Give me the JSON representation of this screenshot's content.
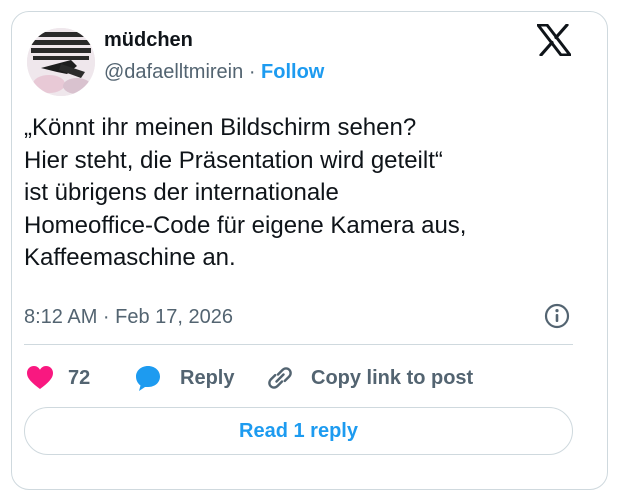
{
  "author": {
    "display_name": "müdchen",
    "handle": "@dafaelltmirein",
    "separator": "·",
    "follow_label": "Follow"
  },
  "tweet": {
    "lines": [
      "„Könnt ihr meinen Bildschirm sehen?",
      "Hier steht, die Präsentation wird geteilt“",
      "ist übrigens der internationale",
      "Homeoffice-Code für eigene Kamera aus,",
      "Kaffeemaschine an."
    ],
    "timestamp": "8:12 AM · Feb 17, 2026"
  },
  "actions": {
    "like_count": "72",
    "reply_label": "Reply",
    "copy_link_label": "Copy link to post",
    "read_replies_label": "Read 1 reply"
  },
  "icons": {
    "brand": "x-logo-icon",
    "info": "info-icon",
    "like": "heart-icon",
    "reply": "speech-bubble-icon",
    "copy": "link-icon"
  },
  "colors": {
    "accent": "#1d9bf0",
    "like": "#f91880",
    "secondary_text": "#536471",
    "border": "#cfd9de"
  }
}
